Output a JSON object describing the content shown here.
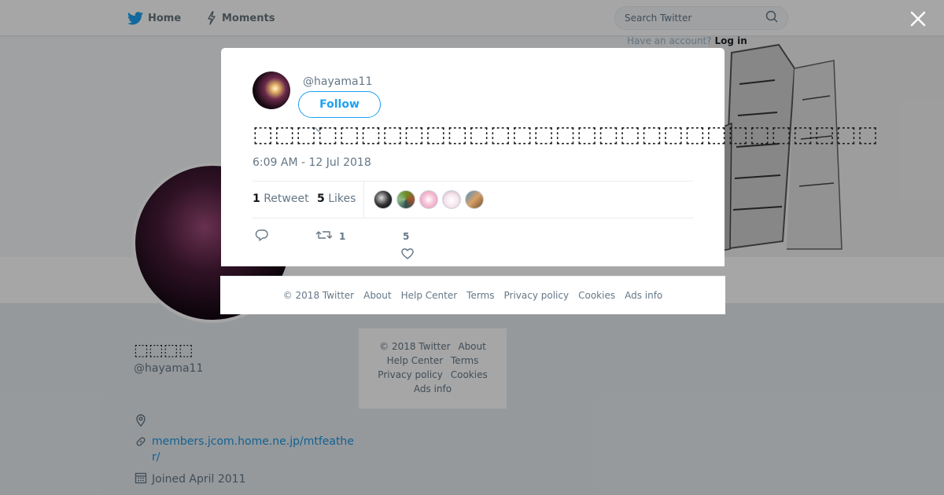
{
  "nav": {
    "home_label": "Home",
    "moments_label": "Moments"
  },
  "search": {
    "placeholder": "Search Twitter"
  },
  "account_prompt": {
    "text": "Have an account?",
    "login_label": "Log in"
  },
  "profile": {
    "name": "⬚⬚⬚⬚",
    "handle": "@hayama11",
    "website": "members.jcom.home.ne.jp/mtfeather/",
    "joined": "Joined April 2011"
  },
  "side_footer": {
    "copyright": "© 2018 Twitter",
    "about": "About",
    "help": "Help Center",
    "terms": "Terms",
    "privacy": "Privacy policy",
    "cookies": "Cookies",
    "ads": "Ads info"
  },
  "tweet": {
    "handle": "@hayama11",
    "follow_label": "Follow",
    "text": "⬚⬚⬚⬚⬚⬚⬚⬚⬚⬚⬚⬚⬚⬚⬚⬚⬚⬚⬚⬚⬚⬚⬚⬚⬚⬚⬚⬚⬚",
    "timestamp": "6:09 AM - 12 Jul 2018",
    "retweet_count": "1",
    "retweet_label": "Retweet",
    "like_count": "5",
    "like_label": "Likes",
    "action_retweet_count": "1",
    "action_like_count": "5"
  },
  "modal_footer": {
    "copyright": "© 2018 Twitter",
    "about": "About",
    "help": "Help Center",
    "terms": "Terms",
    "privacy": "Privacy policy",
    "cookies": "Cookies",
    "ads": "Ads info"
  },
  "colors": {
    "accent": "#1da1f2",
    "link": "#1b95e0",
    "muted_text": "#657786"
  },
  "icons": [
    "twitter-bird-icon",
    "moments-bolt-icon",
    "search-icon",
    "close-icon",
    "reply-icon",
    "retweet-icon",
    "heart-icon",
    "location-pin-icon",
    "link-icon",
    "calendar-icon",
    "caret-down-icon"
  ]
}
